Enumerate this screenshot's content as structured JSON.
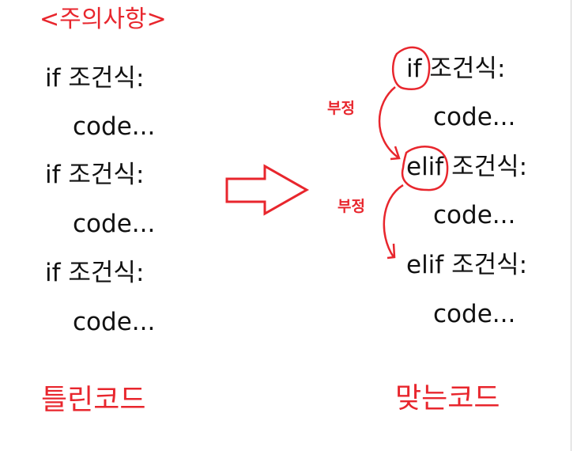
{
  "title": "<주의사항>",
  "wrong": {
    "label": "틀린코드",
    "lines": [
      "if 조건식:",
      "code...",
      "if 조건식:",
      "code...",
      "if 조건식:",
      "code..."
    ]
  },
  "right": {
    "label": "맞는코드",
    "lines": [
      "if 조건식:",
      "code...",
      "elif 조건식:",
      "code...",
      "elif 조건식:",
      "code..."
    ],
    "annotations": [
      "부정",
      "부정"
    ]
  },
  "colors": {
    "accent": "#e8262d",
    "text": "#111111"
  }
}
